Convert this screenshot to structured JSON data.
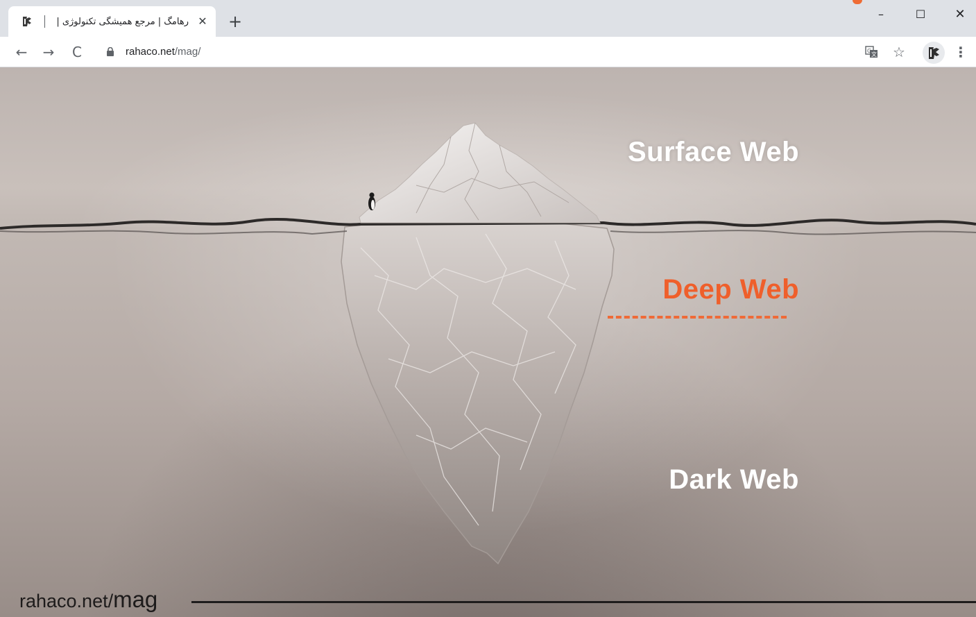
{
  "tab": {
    "title": "رهامگ | مرجع همیشگی تکنولوژی |",
    "close_glyph": "✕"
  },
  "newtab_glyph": "+",
  "window_controls": {
    "minimize": "–",
    "maximize": "☐",
    "close": "✕"
  },
  "toolbar": {
    "back_glyph": "←",
    "forward_glyph": "→",
    "reload_glyph": "C",
    "url_host": "rahaco.net",
    "url_path": "/mag/",
    "star_glyph": "☆",
    "menu_glyph": "⋮"
  },
  "page": {
    "labels": {
      "surface": "Surface Web",
      "deep": "Deep Web",
      "dark": "Dark Web"
    },
    "watermark_host": "rahaco.net/",
    "watermark_path": "mag"
  },
  "colors": {
    "accent": "#ef5f2b",
    "text_light": "#ffffff",
    "chrome_bg": "#dee1e6"
  },
  "icons": {
    "favicon": "rahamag-logo-icon",
    "lock": "lock-icon",
    "translate": "translate-icon",
    "profile": "rahamag-profile-icon"
  }
}
